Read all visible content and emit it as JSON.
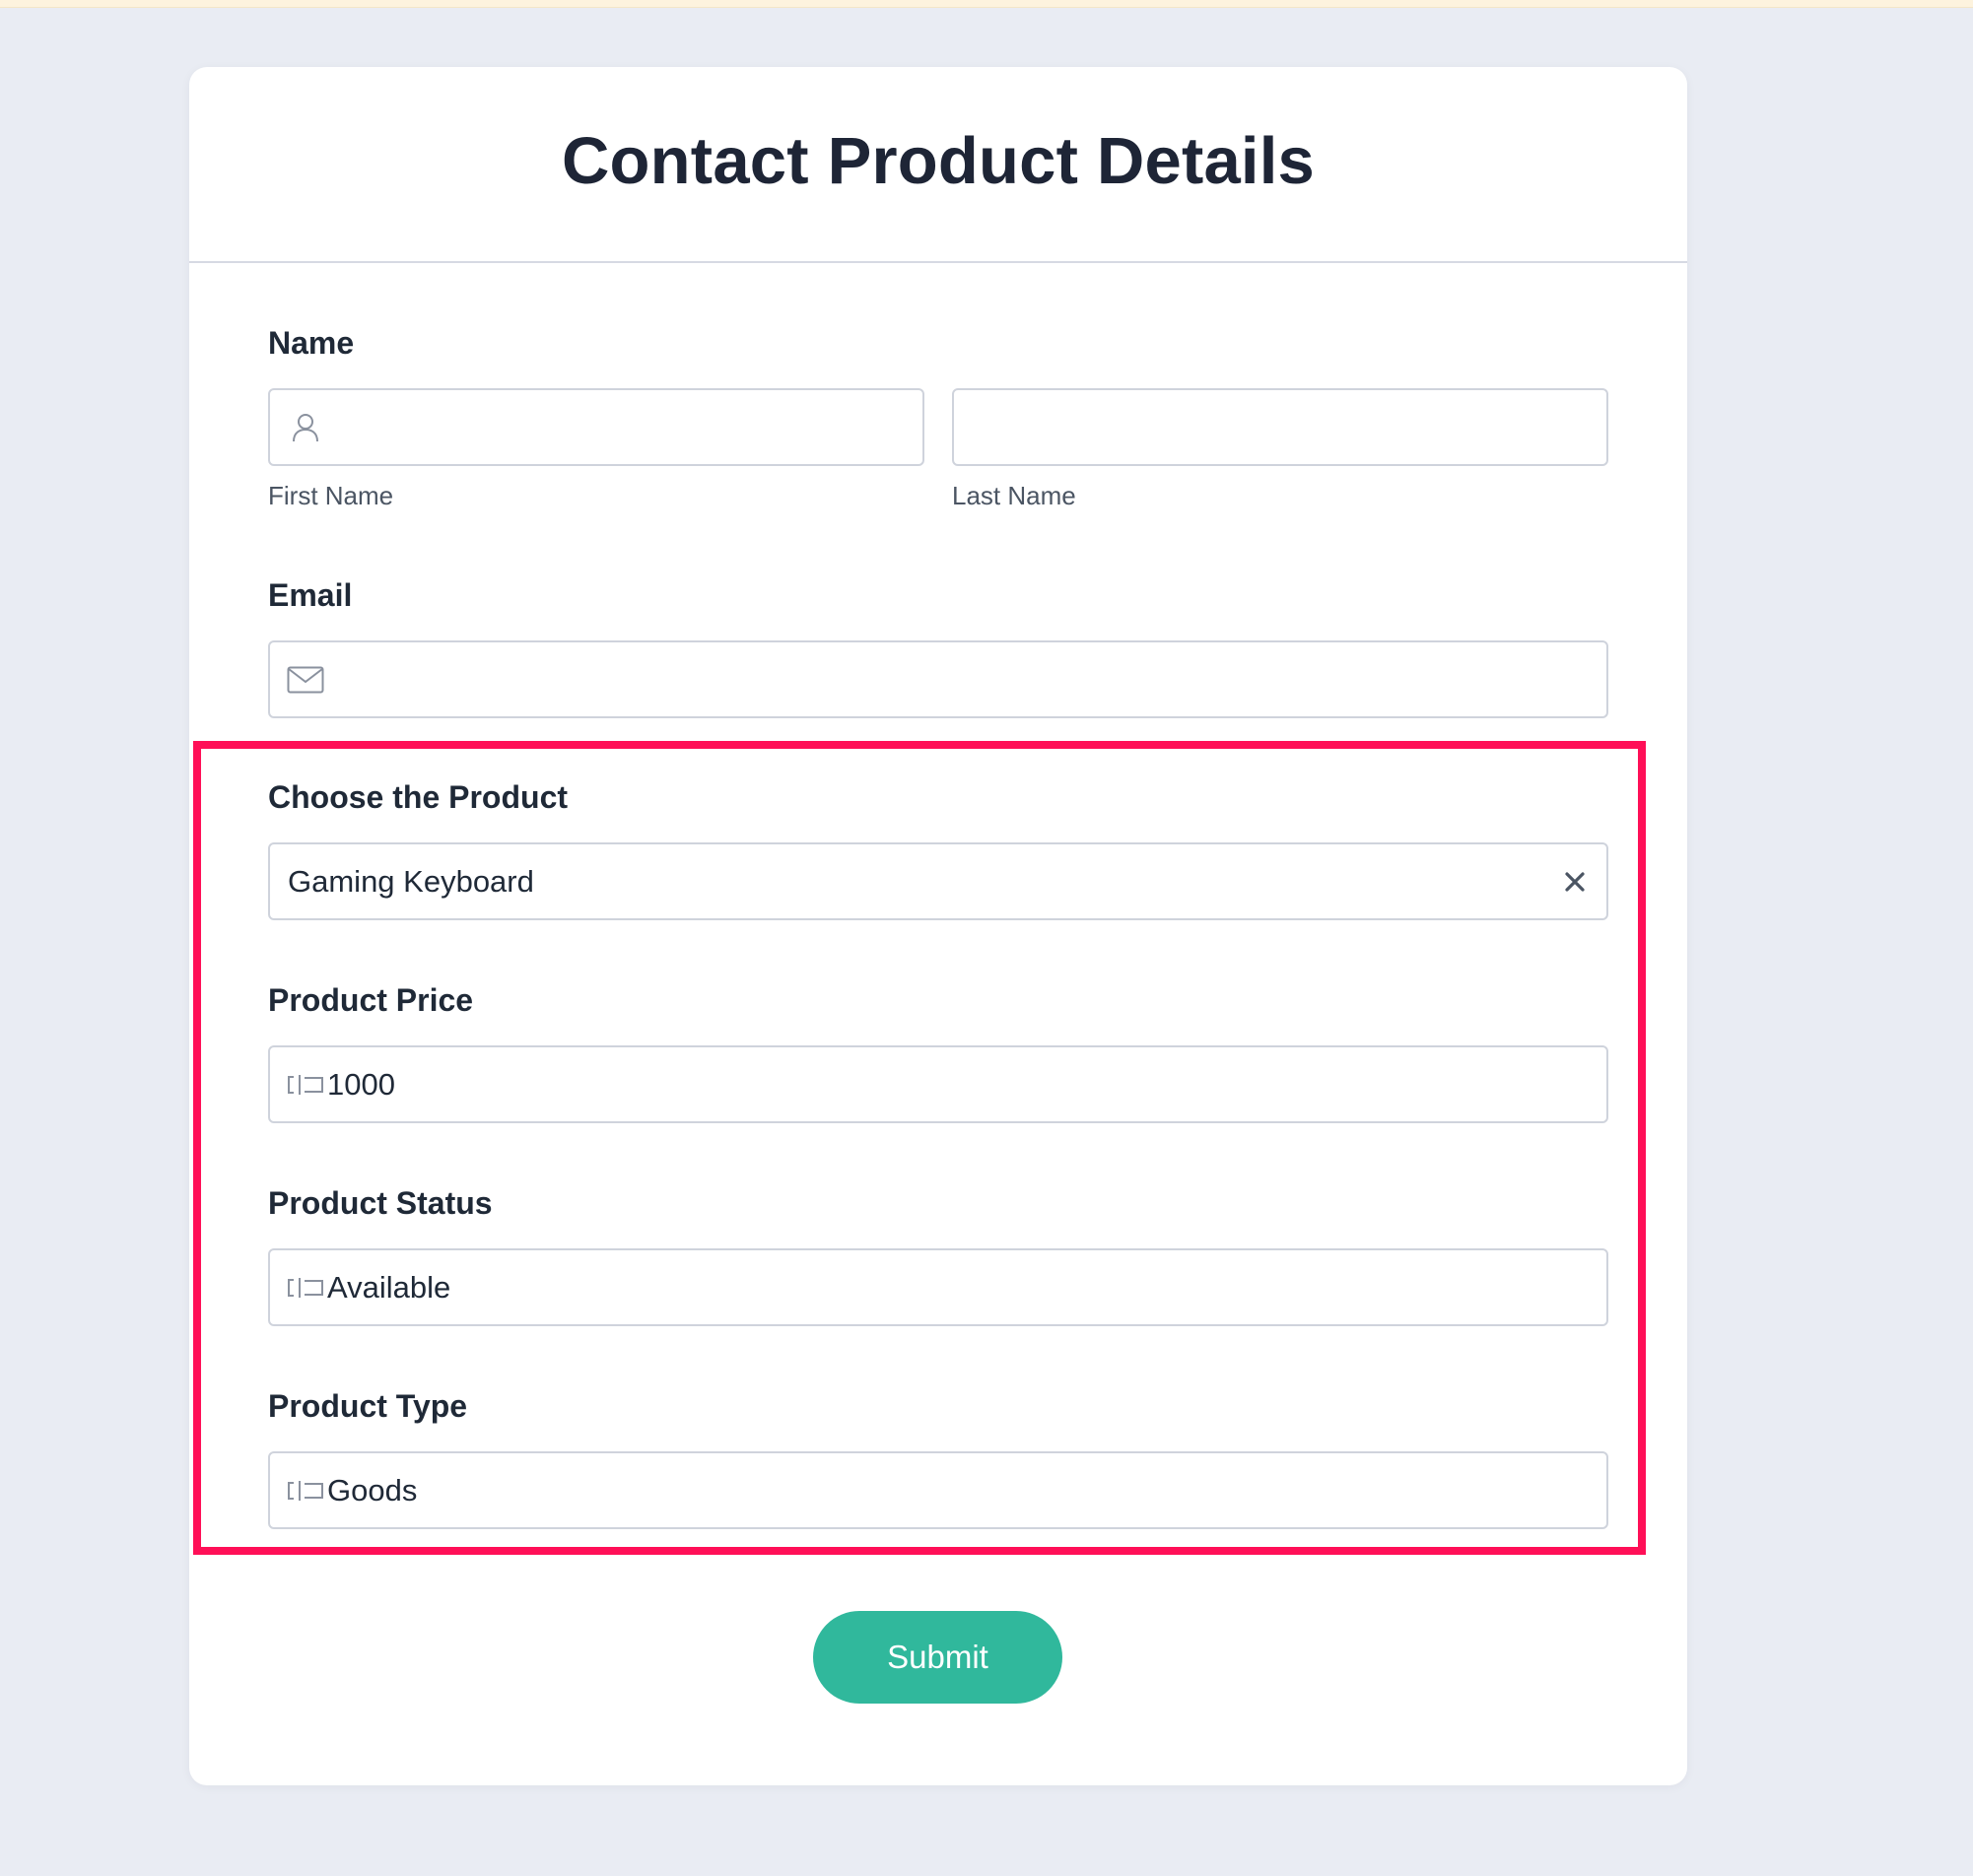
{
  "form": {
    "title": "Contact Product Details",
    "name": {
      "label": "Name",
      "first_name": {
        "value": "",
        "sublabel": "First Name",
        "icon": "user-icon"
      },
      "last_name": {
        "value": "",
        "sublabel": "Last Name"
      }
    },
    "email": {
      "label": "Email",
      "value": "",
      "icon": "envelope-icon"
    },
    "product": {
      "label": "Choose the Product",
      "value": "Gaming Keyboard",
      "clear_icon": "close-icon"
    },
    "price": {
      "label": "Product Price",
      "value": "1000",
      "icon": "text-cursor-icon"
    },
    "status": {
      "label": "Product Status",
      "value": "Available",
      "icon": "text-cursor-icon"
    },
    "type": {
      "label": "Product Type",
      "value": "Goods",
      "icon": "text-cursor-icon"
    },
    "submit_label": "Submit"
  },
  "colors": {
    "page_background": "#e9ecf3",
    "card_background": "#ffffff",
    "highlight_border": "#ff0f57",
    "submit_button": "#30b89c",
    "title_text": "#1e2536"
  }
}
